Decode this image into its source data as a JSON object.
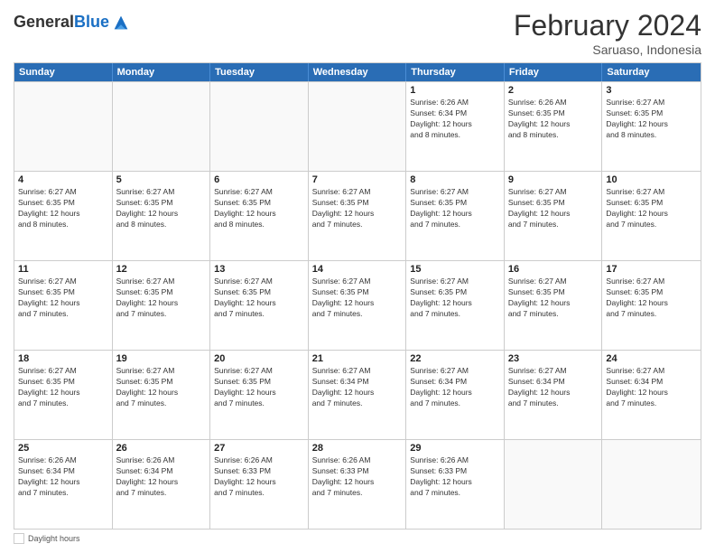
{
  "header": {
    "logo_general": "General",
    "logo_blue": "Blue",
    "month_title": "February 2024",
    "subtitle": "Saruaso, Indonesia"
  },
  "days_of_week": [
    "Sunday",
    "Monday",
    "Tuesday",
    "Wednesday",
    "Thursday",
    "Friday",
    "Saturday"
  ],
  "weeks": [
    [
      {
        "day": "",
        "info": ""
      },
      {
        "day": "",
        "info": ""
      },
      {
        "day": "",
        "info": ""
      },
      {
        "day": "",
        "info": ""
      },
      {
        "day": "1",
        "info": "Sunrise: 6:26 AM\nSunset: 6:34 PM\nDaylight: 12 hours\nand 8 minutes."
      },
      {
        "day": "2",
        "info": "Sunrise: 6:26 AM\nSunset: 6:35 PM\nDaylight: 12 hours\nand 8 minutes."
      },
      {
        "day": "3",
        "info": "Sunrise: 6:27 AM\nSunset: 6:35 PM\nDaylight: 12 hours\nand 8 minutes."
      }
    ],
    [
      {
        "day": "4",
        "info": "Sunrise: 6:27 AM\nSunset: 6:35 PM\nDaylight: 12 hours\nand 8 minutes."
      },
      {
        "day": "5",
        "info": "Sunrise: 6:27 AM\nSunset: 6:35 PM\nDaylight: 12 hours\nand 8 minutes."
      },
      {
        "day": "6",
        "info": "Sunrise: 6:27 AM\nSunset: 6:35 PM\nDaylight: 12 hours\nand 8 minutes."
      },
      {
        "day": "7",
        "info": "Sunrise: 6:27 AM\nSunset: 6:35 PM\nDaylight: 12 hours\nand 7 minutes."
      },
      {
        "day": "8",
        "info": "Sunrise: 6:27 AM\nSunset: 6:35 PM\nDaylight: 12 hours\nand 7 minutes."
      },
      {
        "day": "9",
        "info": "Sunrise: 6:27 AM\nSunset: 6:35 PM\nDaylight: 12 hours\nand 7 minutes."
      },
      {
        "day": "10",
        "info": "Sunrise: 6:27 AM\nSunset: 6:35 PM\nDaylight: 12 hours\nand 7 minutes."
      }
    ],
    [
      {
        "day": "11",
        "info": "Sunrise: 6:27 AM\nSunset: 6:35 PM\nDaylight: 12 hours\nand 7 minutes."
      },
      {
        "day": "12",
        "info": "Sunrise: 6:27 AM\nSunset: 6:35 PM\nDaylight: 12 hours\nand 7 minutes."
      },
      {
        "day": "13",
        "info": "Sunrise: 6:27 AM\nSunset: 6:35 PM\nDaylight: 12 hours\nand 7 minutes."
      },
      {
        "day": "14",
        "info": "Sunrise: 6:27 AM\nSunset: 6:35 PM\nDaylight: 12 hours\nand 7 minutes."
      },
      {
        "day": "15",
        "info": "Sunrise: 6:27 AM\nSunset: 6:35 PM\nDaylight: 12 hours\nand 7 minutes."
      },
      {
        "day": "16",
        "info": "Sunrise: 6:27 AM\nSunset: 6:35 PM\nDaylight: 12 hours\nand 7 minutes."
      },
      {
        "day": "17",
        "info": "Sunrise: 6:27 AM\nSunset: 6:35 PM\nDaylight: 12 hours\nand 7 minutes."
      }
    ],
    [
      {
        "day": "18",
        "info": "Sunrise: 6:27 AM\nSunset: 6:35 PM\nDaylight: 12 hours\nand 7 minutes."
      },
      {
        "day": "19",
        "info": "Sunrise: 6:27 AM\nSunset: 6:35 PM\nDaylight: 12 hours\nand 7 minutes."
      },
      {
        "day": "20",
        "info": "Sunrise: 6:27 AM\nSunset: 6:35 PM\nDaylight: 12 hours\nand 7 minutes."
      },
      {
        "day": "21",
        "info": "Sunrise: 6:27 AM\nSunset: 6:34 PM\nDaylight: 12 hours\nand 7 minutes."
      },
      {
        "day": "22",
        "info": "Sunrise: 6:27 AM\nSunset: 6:34 PM\nDaylight: 12 hours\nand 7 minutes."
      },
      {
        "day": "23",
        "info": "Sunrise: 6:27 AM\nSunset: 6:34 PM\nDaylight: 12 hours\nand 7 minutes."
      },
      {
        "day": "24",
        "info": "Sunrise: 6:27 AM\nSunset: 6:34 PM\nDaylight: 12 hours\nand 7 minutes."
      }
    ],
    [
      {
        "day": "25",
        "info": "Sunrise: 6:26 AM\nSunset: 6:34 PM\nDaylight: 12 hours\nand 7 minutes."
      },
      {
        "day": "26",
        "info": "Sunrise: 6:26 AM\nSunset: 6:34 PM\nDaylight: 12 hours\nand 7 minutes."
      },
      {
        "day": "27",
        "info": "Sunrise: 6:26 AM\nSunset: 6:33 PM\nDaylight: 12 hours\nand 7 minutes."
      },
      {
        "day": "28",
        "info": "Sunrise: 6:26 AM\nSunset: 6:33 PM\nDaylight: 12 hours\nand 7 minutes."
      },
      {
        "day": "29",
        "info": "Sunrise: 6:26 AM\nSunset: 6:33 PM\nDaylight: 12 hours\nand 7 minutes."
      },
      {
        "day": "",
        "info": ""
      },
      {
        "day": "",
        "info": ""
      }
    ]
  ],
  "footer": {
    "daylight_label": "Daylight hours"
  }
}
